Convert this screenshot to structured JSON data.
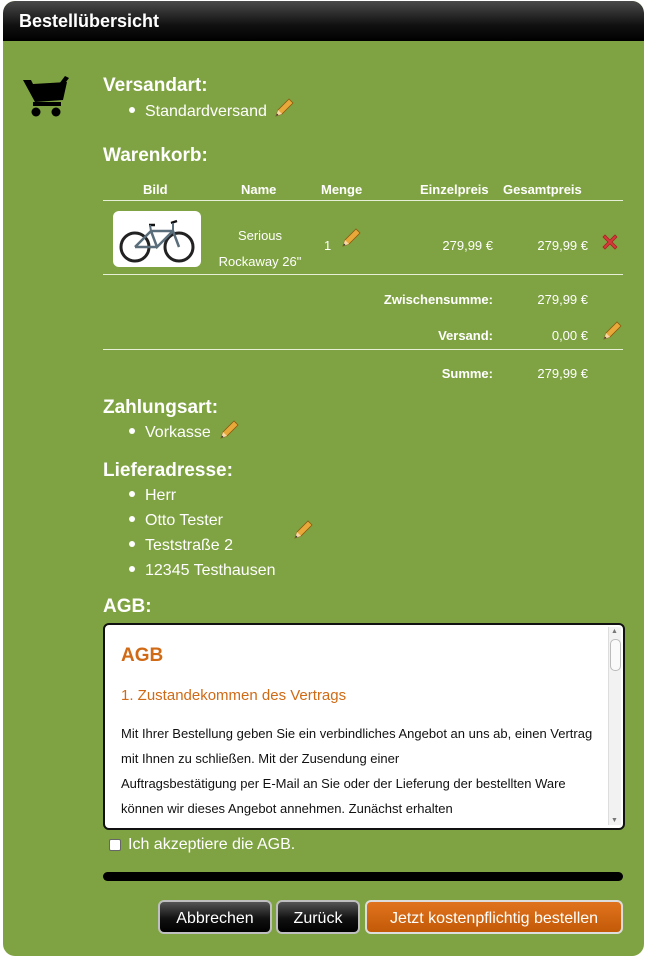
{
  "header": {
    "title": "Bestellübersicht"
  },
  "shipping": {
    "title": "Versandart:",
    "method": "Standardversand"
  },
  "cart": {
    "title": "Warenkorb:",
    "columns": [
      "Bild",
      "Name",
      "Menge",
      "Einzelpreis",
      "Gesamtpreis"
    ],
    "items": [
      {
        "name_line1": "Serious",
        "name_line2": "Rockaway 26\"",
        "quantity": "1",
        "unit_price": "279,99 €",
        "total_price": "279,99 €"
      }
    ],
    "subtotal_label": "Zwischensumme:",
    "subtotal": "279,99 €",
    "shipping_label": "Versand:",
    "shipping_cost": "0,00 €",
    "total_label": "Summe:",
    "total": "279,99 €"
  },
  "payment": {
    "title": "Zahlungsart:",
    "method": "Vorkasse"
  },
  "address": {
    "title": "Lieferadresse:",
    "lines": [
      "Herr",
      "Otto Tester",
      "Teststraße 2",
      "12345 Testhausen"
    ]
  },
  "terms": {
    "title": "AGB:",
    "box_heading": "AGB",
    "section_heading": "1. Zustandekommen des Vertrags",
    "paragraph_lines": [
      "Mit Ihrer Bestellung geben Sie ein verbindliches Angebot an uns ab, einen Vertrag",
      "mit Ihnen zu schließen. Mit der Zusendung einer",
      "Auftragsbestätigung per E-Mail an Sie oder der Lieferung der bestellten Ware",
      "können wir dieses Angebot annehmen. Zunächst erhalten"
    ],
    "accept_label": "Ich akzeptiere die AGB.",
    "accepted": false
  },
  "buttons": {
    "cancel": "Abbrechen",
    "back": "Zurück",
    "order": "Jetzt kostenpflichtig bestellen"
  },
  "colors": {
    "panel": "#7fa342",
    "accent": "#d06a15",
    "remove": "#d43a3a",
    "pencil": "#e8a93a"
  },
  "icons": [
    "shopping-cart-icon",
    "pencil-icon",
    "remove-x-icon",
    "bicycle-image"
  ]
}
